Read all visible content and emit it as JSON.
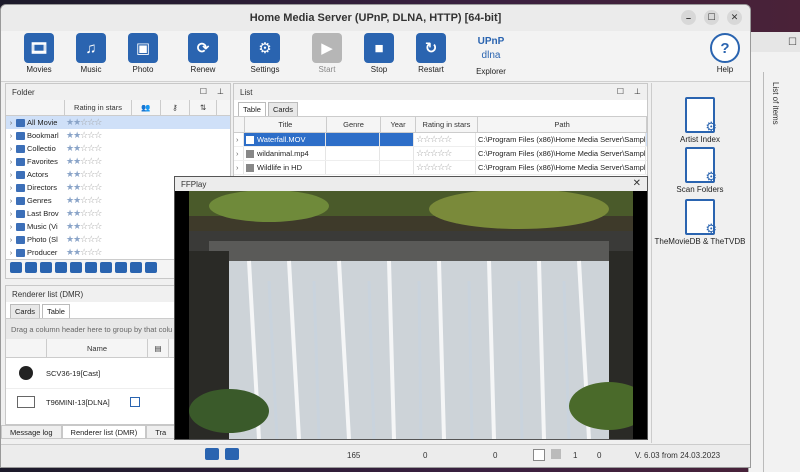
{
  "window_title": "Home Media Server (UPnP, DLNA, HTTP) [64-bit]",
  "toolbar": {
    "movies": "Movies",
    "music": "Music",
    "photo": "Photo",
    "renew": "Renew",
    "settings": "Settings",
    "start": "Start",
    "stop": "Stop",
    "restart": "Restart",
    "explorer": "Explorer",
    "help": "Help",
    "upnp_logo": "UPnP",
    "dlna_logo": "dlna"
  },
  "folder_panel": {
    "title": "Folder",
    "col_rating": "Rating in stars",
    "items": [
      "All Movie",
      "Bookmarl",
      "Collectio",
      "Favorites",
      "Actors",
      "Directors",
      "Genres",
      "Last Brov",
      "Music (Vi",
      "Photo (Sl",
      "Producer"
    ]
  },
  "list_panel": {
    "title": "List",
    "tabs": [
      "Table",
      "Cards"
    ],
    "columns": [
      "Title",
      "Genre",
      "Year",
      "Rating in stars",
      "Path"
    ],
    "rows": [
      {
        "title": "Waterfall.MOV",
        "path": "C:\\Program Files (x86)\\Home Media Server\\Sample"
      },
      {
        "title": "wildanimal.mp4",
        "path": "C:\\Program Files (x86)\\Home Media Server\\Sample"
      },
      {
        "title": "Wildlife in HD",
        "path": "C:\\Program Files (x86)\\Home Media Server\\Sample"
      }
    ]
  },
  "right_buttons": {
    "artist_index": "Artist Index",
    "scan_folders": "Scan Folders",
    "tmdb": "TheMovieDB & TheTVDB"
  },
  "renderer_panel": {
    "title": "Renderer list (DMR)",
    "tabs": [
      "Cards",
      "Table"
    ],
    "group_hint": "Drag a column header here to group by that colu",
    "col_name": "Name",
    "rows": [
      "SCV36-19[Cast]",
      "T96MINI-13[DLNA]"
    ]
  },
  "bottom_tabs": [
    "Message log",
    "Renderer list (DMR)",
    "Tra"
  ],
  "ffplay": {
    "title": "FFPlay"
  },
  "statusbar": {
    "count1": "165",
    "count2": "0",
    "count3": "0",
    "count4": "1",
    "count5": "0",
    "version": "V. 6.03 from 24.03.2023"
  },
  "bg_window": {
    "label": "List of items"
  },
  "colors": {
    "accent": "#2a64b0",
    "selection": "#2d6ec8"
  }
}
